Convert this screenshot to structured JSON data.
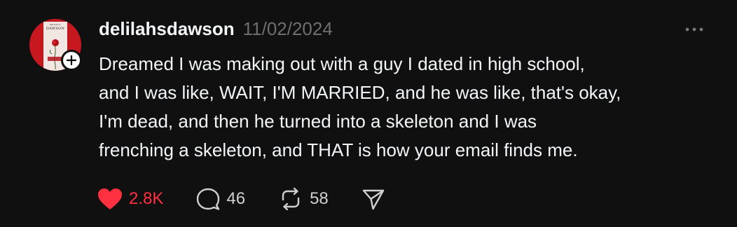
{
  "post": {
    "author": {
      "username": "delilahsdawson",
      "avatar_alt_text": "DAWSON",
      "avatar_small_text": "DELILAH S."
    },
    "timestamp": "11/02/2024",
    "text": "Dreamed I was making out with a guy I dated in high school,\nand I was like, WAIT, I'M MARRIED, and he was like, that's okay,\nI'm dead, and then he turned into a skeleton and I was\nfrenching a skeleton, and THAT is how your email finds me.",
    "actions": {
      "likes": "2.8K",
      "replies": "46",
      "reposts": "58"
    }
  },
  "icons": {
    "like": "heart-icon",
    "reply": "speech-bubble-icon",
    "repost": "repost-icon",
    "share": "send-icon",
    "more": "more-dots-icon",
    "follow": "plus-icon"
  },
  "colors": {
    "background": "#101010",
    "text": "#f3f5f7",
    "muted": "#6e6e6e",
    "like": "#ff3040"
  }
}
